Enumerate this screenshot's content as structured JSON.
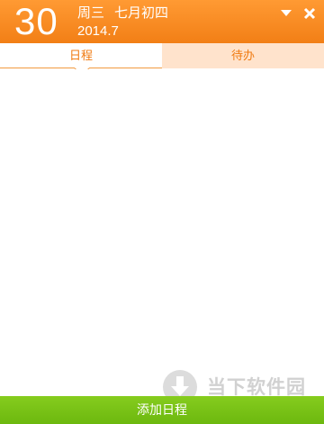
{
  "header": {
    "day": "30",
    "weekday": "周三",
    "lunar_date": "七月初四",
    "year_month": "2014.7",
    "colors": {
      "accent": "#f58a1f",
      "white": "#ffffff"
    },
    "icons": {
      "dropdown": "triangle-down-icon",
      "close": "close-icon"
    }
  },
  "tabs": [
    {
      "label": "日程",
      "active": true
    },
    {
      "label": "待办",
      "active": false
    }
  ],
  "colors": {
    "tab_inactive_bg": "#ffe3cc",
    "add_button": "#74bf14",
    "text_orange": "#f07a10"
  },
  "watermark": {
    "text": "当下软件园",
    "icon": "download-arrow-icon"
  },
  "footer": {
    "add_label": "添加日程"
  }
}
